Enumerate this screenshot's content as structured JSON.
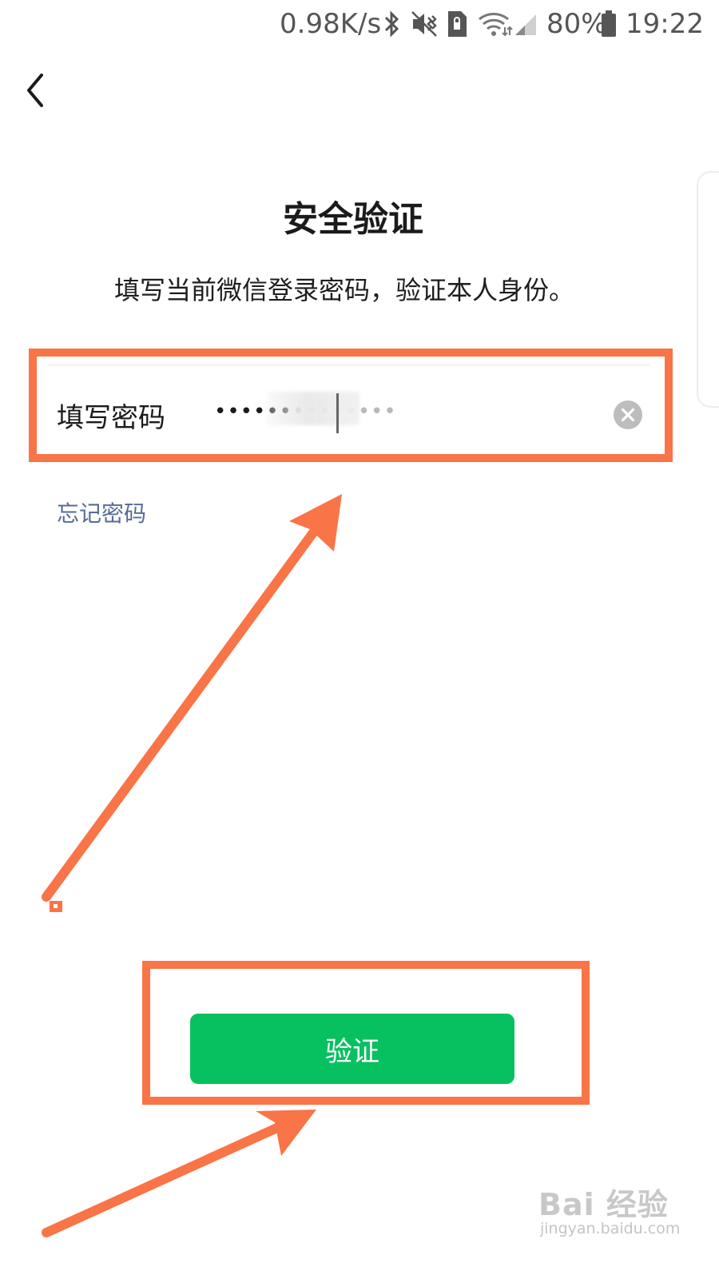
{
  "status_bar": {
    "network_speed": "0.98K/s",
    "battery": "80%",
    "time": "19:22",
    "icons": [
      "bluetooth-icon",
      "mute-vibrate-icon",
      "sim-lock-icon",
      "wifi-icon",
      "signal-icon",
      "battery-icon"
    ]
  },
  "nav": {
    "back_icon": "chevron-left-icon"
  },
  "header": {
    "title": "安全验证",
    "subtitle": "填写当前微信登录密码，验证本人身份。"
  },
  "password_field": {
    "label": "填写密码",
    "value_masked": "••••••",
    "value_masked_faded": "••••••••",
    "clear_icon": "clear-circle-icon"
  },
  "forgot_link": {
    "label": "忘记密码"
  },
  "verify_button": {
    "label": "验证"
  },
  "annotations": {
    "color": "#f97447"
  },
  "colors": {
    "primary_green": "#07c160",
    "link_blue": "#576b95"
  },
  "watermark": {
    "logo": "Bai 经验",
    "url": "jingyan.baidu.com"
  }
}
